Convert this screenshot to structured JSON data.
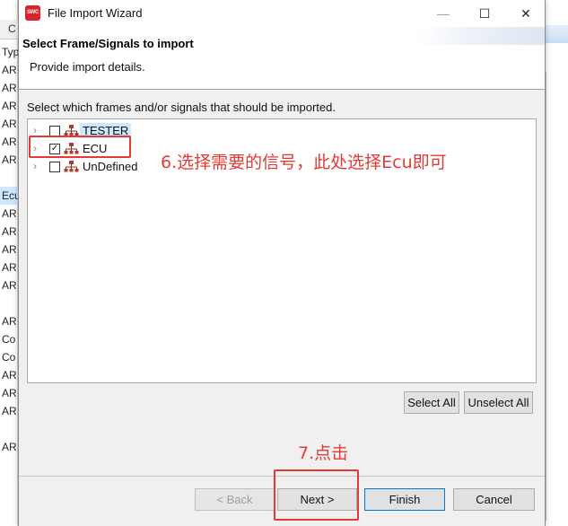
{
  "background": {
    "left_tab": "C",
    "left_rows": [
      "Typ",
      "AR",
      "AR",
      "AR",
      "AR",
      "AR",
      "AR",
      "Ecu",
      "AR",
      "AR",
      "AR",
      "AR",
      "AR",
      "AR",
      "Co",
      "Co",
      "AR",
      "AR",
      "AR",
      "AR"
    ],
    "selected_row_index": 7
  },
  "window": {
    "title": "File Import Wizard",
    "icon_text": "SWC",
    "minimize_glyph": "—",
    "maximize_glyph": "☐",
    "close_glyph": "✕"
  },
  "header": {
    "title": "Select Frame/Signals to import",
    "description": "Provide import details."
  },
  "section": {
    "label": "Select which frames and/or signals that should be imported."
  },
  "tree": {
    "items": [
      {
        "label": "TESTER",
        "checked": false,
        "check_glyph": ""
      },
      {
        "label": "ECU",
        "checked": true,
        "check_glyph": "✓"
      },
      {
        "label": "UnDefined",
        "checked": false,
        "check_glyph": ""
      }
    ],
    "expander_glyph": "›"
  },
  "buttons": {
    "select_all": "Select All",
    "unselect_all": "Unselect All",
    "back": "< Back",
    "next": "Next >",
    "finish": "Finish",
    "cancel": "Cancel"
  },
  "annotations": {
    "step6": "6.选择需要的信号，此处选择Ecu即可",
    "step7": "7.点击",
    "color": "#e53935"
  },
  "colors": {
    "selection": "#cce8ff",
    "default_button_border": "#0078d7",
    "icon_red": "#d9242b"
  }
}
